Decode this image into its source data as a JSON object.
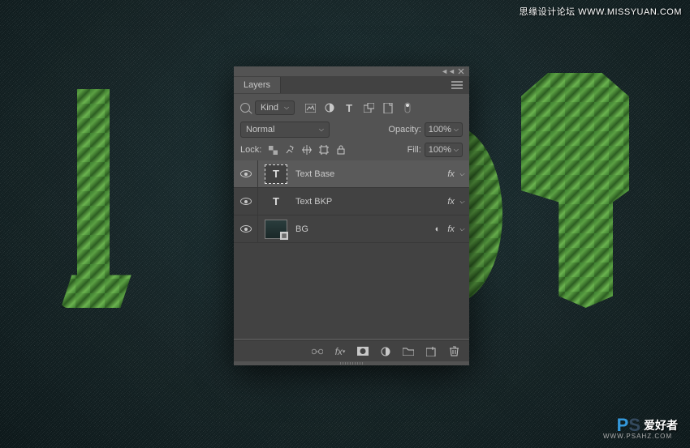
{
  "watermarks": {
    "top_right": "思缘设计论坛  WWW.MISSYUAN.COM",
    "bottom_brand": "爱好者",
    "bottom_url": "WWW.PSAHZ.COM",
    "ps_p": "P",
    "ps_s": "S"
  },
  "panel": {
    "title": "Layers",
    "kind_label": "Kind",
    "blend_mode": "Normal",
    "opacity_label": "Opacity:",
    "opacity_value": "100%",
    "lock_label": "Lock:",
    "fill_label": "Fill:",
    "fill_value": "100%",
    "fx_label": "fx"
  },
  "layers": [
    {
      "name": "Text Base",
      "type": "T",
      "selected": true,
      "fx": true,
      "smart": false,
      "visible": true
    },
    {
      "name": "Text BKP",
      "type": "T",
      "selected": false,
      "fx": true,
      "smart": false,
      "visible": true
    },
    {
      "name": "BG",
      "type": "img",
      "selected": false,
      "fx": true,
      "smart": true,
      "visible": true
    }
  ]
}
